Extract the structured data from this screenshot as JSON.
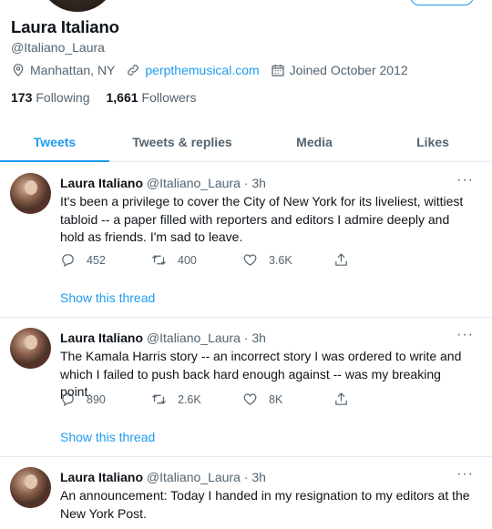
{
  "profile": {
    "name": "Laura Italiano",
    "handle": "@Italiano_Laura",
    "location": "Manhattan, NY",
    "website": "perpthemusical.com",
    "joined": "Joined October 2012",
    "following_count": "173",
    "following_label": "Following",
    "followers_count": "1,661",
    "followers_label": "Followers"
  },
  "tabs": [
    {
      "label": "Tweets",
      "active": true
    },
    {
      "label": "Tweets & replies",
      "active": false
    },
    {
      "label": "Media",
      "active": false
    },
    {
      "label": "Likes",
      "active": false
    }
  ],
  "tweets": [
    {
      "name": "Laura Italiano",
      "meta": "@Italiano_Laura · 3h",
      "text": "It's been a privilege to cover the City of New York for its liveliest, wittiest tabloid -- a paper filled with reporters and editors I admire deeply and hold as friends. I'm sad to leave.",
      "replies": "452",
      "retweets": "400",
      "likes": "3.6K",
      "show_thread": "Show this thread"
    },
    {
      "name": "Laura Italiano",
      "meta": "@Italiano_Laura · 3h",
      "text": "The Kamala Harris story -- an incorrect story I was ordered to write and which I failed to push back hard enough against -- was my breaking point.",
      "replies": "890",
      "retweets": "2.6K",
      "likes": "8K",
      "show_thread": "Show this thread"
    },
    {
      "name": "Laura Italiano",
      "meta": "@Italiano_Laura · 3h",
      "text": "An announcement: Today I handed in my resignation to my editors at the New York Post."
    }
  ],
  "more_glyph": "···",
  "colors": {
    "accent": "#1d9bf0",
    "muted": "#536471",
    "text": "#0f1419",
    "divider": "#e6ecf0"
  }
}
